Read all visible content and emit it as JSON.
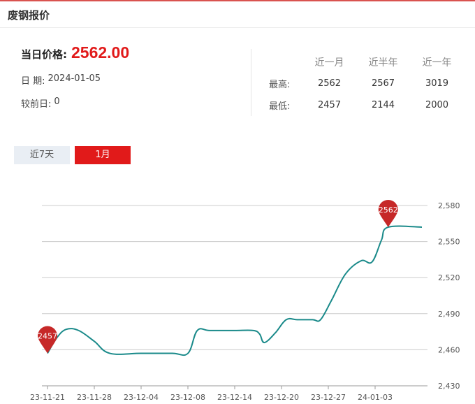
{
  "header": {
    "title": "废钢报价"
  },
  "summary": {
    "price_label": "当日价格:",
    "price_value": "2562.00",
    "date_label": "日 期:",
    "date_value": "2024-01-05",
    "change_label": "较前日:",
    "change_value": "0"
  },
  "stats": {
    "headers": [
      "近一月",
      "近半年",
      "近一年"
    ],
    "rows": [
      {
        "label": "最高:",
        "values": [
          "2562",
          "2567",
          "3019"
        ]
      },
      {
        "label": "最低:",
        "values": [
          "2457",
          "2144",
          "2000"
        ]
      }
    ]
  },
  "tabs": [
    {
      "label": "近7天",
      "active": false
    },
    {
      "label": "1月",
      "active": true
    }
  ],
  "colors": {
    "accent": "#e11a1a",
    "line": "#1a8a8a",
    "marker": "#c62828",
    "grid": "#cccccc"
  },
  "chart_data": {
    "type": "line",
    "x_tick_labels": [
      "23-11-21",
      "23-11-28",
      "23-12-04",
      "23-12-08",
      "23-12-14",
      "23-12-20",
      "23-12-27",
      "24-01-03"
    ],
    "y_ticks": [
      2430,
      2460,
      2490,
      2520,
      2550,
      2580
    ],
    "y_tick_labels": [
      "2,430",
      "2,460",
      "2,490",
      "2,520",
      "2,550",
      "2,580"
    ],
    "ylim": [
      2430,
      2580
    ],
    "series": [
      {
        "values": [
          [
            0,
            2457
          ],
          [
            0.3,
            2470
          ],
          [
            0.6,
            2477
          ],
          [
            1.0,
            2476
          ],
          [
            1.5,
            2467
          ],
          [
            2.0,
            2457
          ],
          [
            3.0,
            2457
          ],
          [
            4.0,
            2457
          ],
          [
            4.5,
            2457
          ],
          [
            4.8,
            2476
          ],
          [
            5.2,
            2476
          ],
          [
            6.0,
            2476
          ],
          [
            6.6,
            2476
          ],
          [
            6.8,
            2473
          ],
          [
            6.95,
            2466
          ],
          [
            7.3,
            2474
          ],
          [
            7.65,
            2485
          ],
          [
            8.0,
            2485
          ],
          [
            8.5,
            2485
          ],
          [
            8.75,
            2485
          ],
          [
            9.1,
            2501
          ],
          [
            9.55,
            2523
          ],
          [
            10.05,
            2534
          ],
          [
            10.4,
            2533
          ],
          [
            10.7,
            2551
          ],
          [
            10.92,
            2562
          ],
          [
            12.0,
            2562
          ]
        ]
      }
    ],
    "markers": [
      {
        "label": "2457",
        "x": 0,
        "y": 2457
      },
      {
        "label": "2562",
        "x": 10.92,
        "y": 2562
      }
    ]
  }
}
